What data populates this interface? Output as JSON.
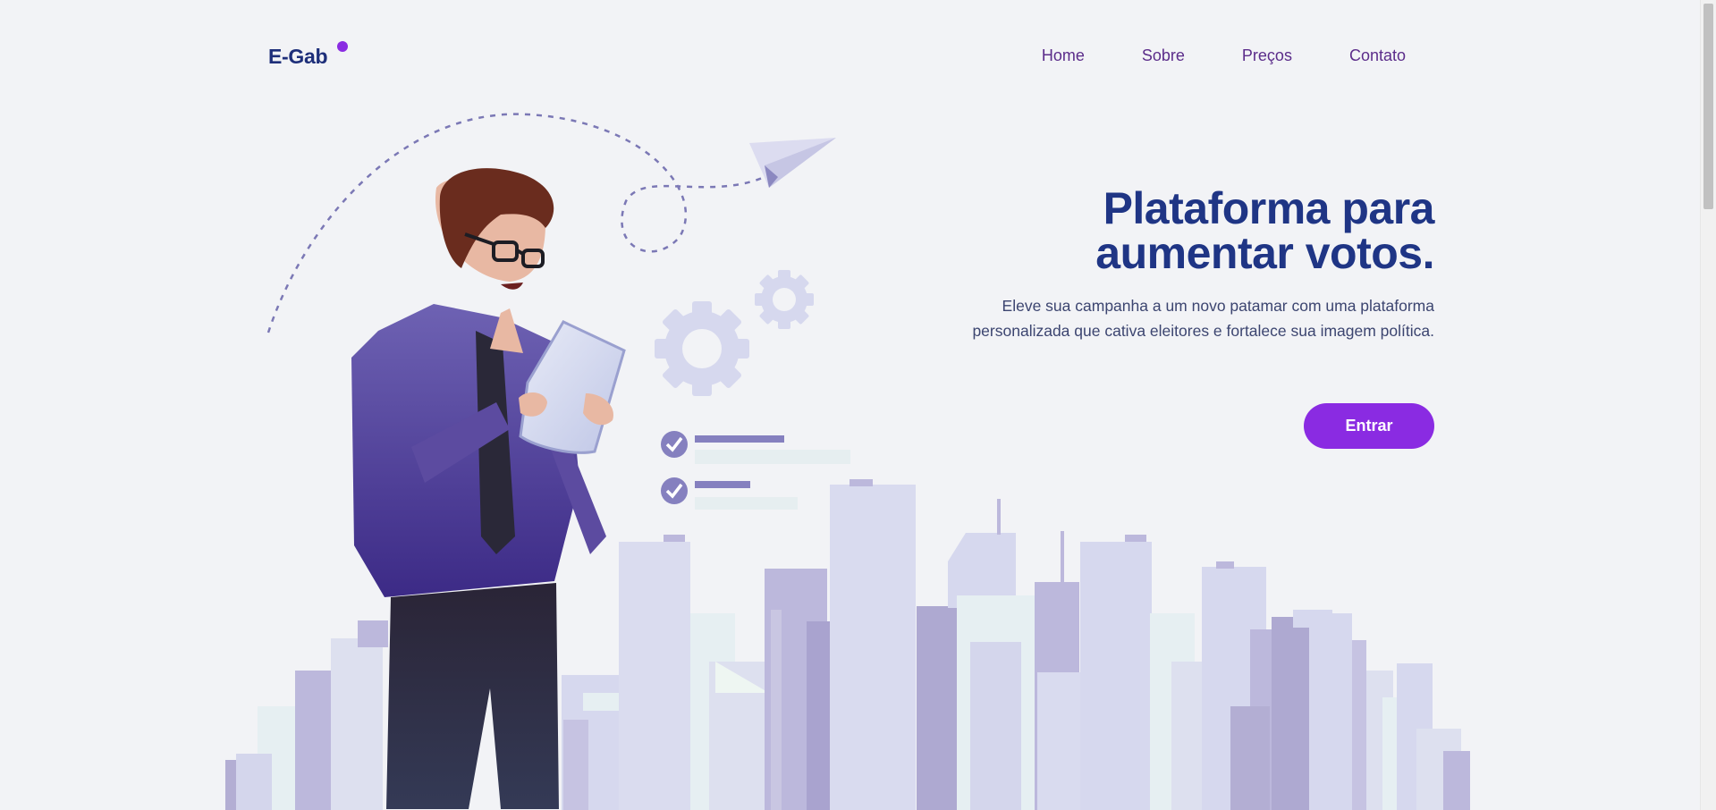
{
  "brand": {
    "name": "E-Gab"
  },
  "nav": {
    "items": [
      "Home",
      "Sobre",
      "Preços",
      "Contato"
    ]
  },
  "hero": {
    "title_line1": "Plataforma para",
    "title_line2": "aumentar votos.",
    "subtitle": "Eleve sua campanha a um novo patamar com uma plataforma personalizada que cativa eleitores e fortalece sua imagem política.",
    "cta_label": "Entrar"
  },
  "colors": {
    "background": "#f2f3f6",
    "brand": "#1e2f7a",
    "accent": "#8a2be2",
    "nav_text": "#5b2c8a",
    "illustration": "#d6d9ee"
  },
  "icons": [
    "paper-plane-icon",
    "gear-icon",
    "check-icon"
  ]
}
